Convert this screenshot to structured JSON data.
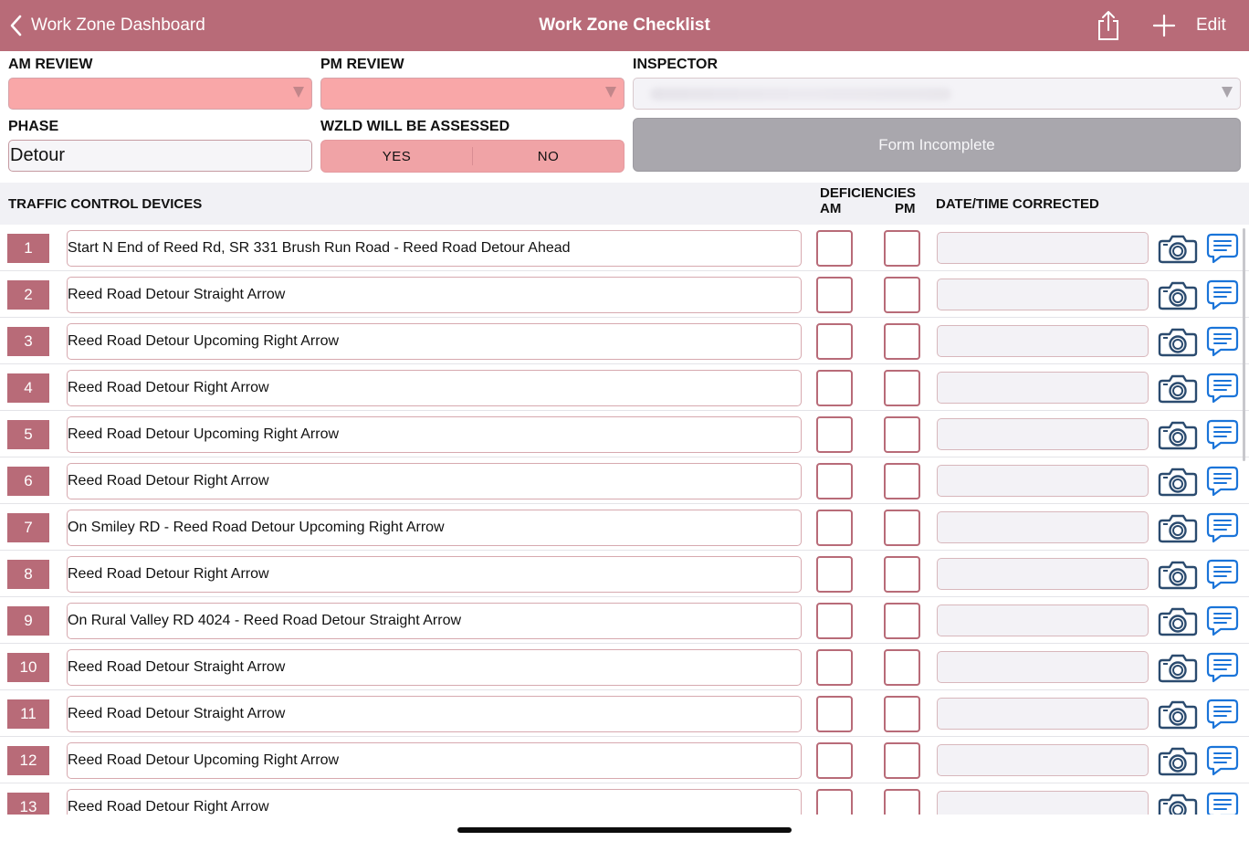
{
  "navbar": {
    "back_label": "Work Zone Dashboard",
    "title": "Work Zone Checklist",
    "edit_label": "Edit",
    "icons": {
      "back": "chevron-left-icon",
      "share": "share-icon",
      "add": "plus-icon"
    }
  },
  "form": {
    "am_review_label": "AM REVIEW",
    "am_review_value": "",
    "pm_review_label": "PM REVIEW",
    "pm_review_value": "",
    "inspector_label": "INSPECTOR",
    "phase_label": "PHASE",
    "phase_value": "Detour",
    "wzld_label": "WZLD WILL BE ASSESSED",
    "wzld_yes": "YES",
    "wzld_no": "NO",
    "status": "Form Incomplete"
  },
  "table": {
    "devices_header": "TRAFFIC CONTROL DEVICES",
    "deficiencies_header": "DEFICIENCIES",
    "am_header": "AM",
    "pm_header": "PM",
    "date_header": "DATE/TIME CORRECTED",
    "rows": [
      {
        "num": "1",
        "text": "Start N End of Reed Rd, SR 331 Brush Run Road - Reed Road Detour Ahead"
      },
      {
        "num": "2",
        "text": "Reed Road Detour Straight Arrow"
      },
      {
        "num": "3",
        "text": "Reed Road Detour Upcoming Right Arrow"
      },
      {
        "num": "4",
        "text": "Reed Road Detour Right Arrow"
      },
      {
        "num": "5",
        "text": "Reed Road Detour Upcoming Right Arrow"
      },
      {
        "num": "6",
        "text": "Reed Road Detour Right Arrow"
      },
      {
        "num": "7",
        "text": "On Smiley RD - Reed Road Detour Upcoming Right Arrow"
      },
      {
        "num": "8",
        "text": "Reed Road Detour Right Arrow"
      },
      {
        "num": "9",
        "text": "On Rural Valley RD 4024 - Reed Road Detour Straight Arrow"
      },
      {
        "num": "10",
        "text": "Reed Road Detour Straight Arrow"
      },
      {
        "num": "11",
        "text": "Reed Road Detour Straight Arrow"
      },
      {
        "num": "12",
        "text": "Reed Road Detour Upcoming Right Arrow"
      },
      {
        "num": "13",
        "text": "Reed Road Detour Right Arrow"
      }
    ]
  },
  "colors": {
    "brand": "#b86b78",
    "dropdown_fill": "#f9a7a8",
    "segment_fill": "#f0a3a6",
    "status_fill": "#a9a7ad",
    "icon_blue": "#1a74d9",
    "camera_navy": "#2b4b6f"
  }
}
